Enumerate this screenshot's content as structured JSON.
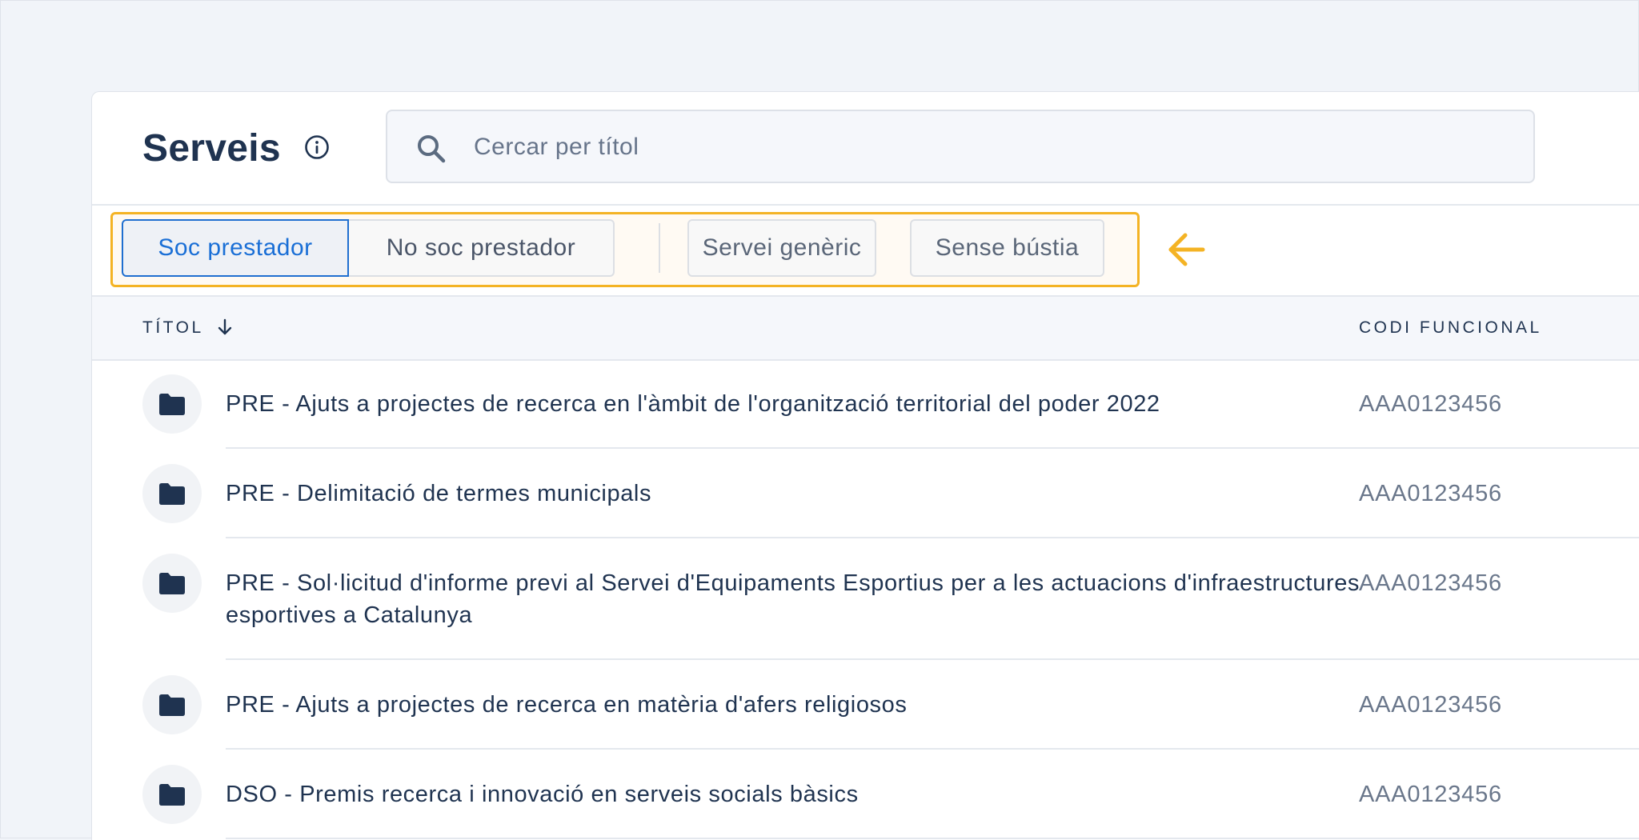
{
  "header": {
    "title": "Serveis",
    "info_icon": "info-circle-icon"
  },
  "search": {
    "placeholder": "Cercar per títol",
    "value": "",
    "icon": "search-icon"
  },
  "filters": {
    "segment": [
      {
        "label": "Soc prestador",
        "selected": true
      },
      {
        "label": "No soc prestador",
        "selected": false
      }
    ],
    "chips": [
      {
        "label": "Servei genèric",
        "selected": false
      },
      {
        "label": "Sense bústia",
        "selected": false
      }
    ],
    "highlight_color": "#f4b324",
    "annotation_icon": "arrow-left-icon"
  },
  "table": {
    "columns": [
      {
        "label": "TÍTOL",
        "sort": "desc"
      },
      {
        "label": "CODI FUNCIONAL"
      }
    ],
    "rows": [
      {
        "icon": "folder-icon",
        "title": "PRE - Ajuts a projectes de recerca en l'àmbit de l'organització territorial del poder 2022",
        "code": "AAA0123456"
      },
      {
        "icon": "folder-icon",
        "title": "PRE - Delimitació de termes municipals",
        "code": "AAA0123456"
      },
      {
        "icon": "folder-icon",
        "title": "PRE - Sol·licitud d'informe previ al Servei d'Equipaments Esportius per a les actuacions d'infraestructures esportives a Catalunya",
        "code": "AAA0123456"
      },
      {
        "icon": "folder-icon",
        "title": "PRE - Ajuts a projectes de recerca en matèria d'afers religiosos",
        "code": "AAA0123456"
      },
      {
        "icon": "folder-icon",
        "title": "DSO - Premis recerca i innovació en serveis socials bàsics",
        "code": "AAA0123456"
      }
    ]
  },
  "colors": {
    "accent": "#1f6fd0",
    "text": "#1f3350",
    "muted": "#6a778b",
    "highlight": "#f4b324"
  }
}
